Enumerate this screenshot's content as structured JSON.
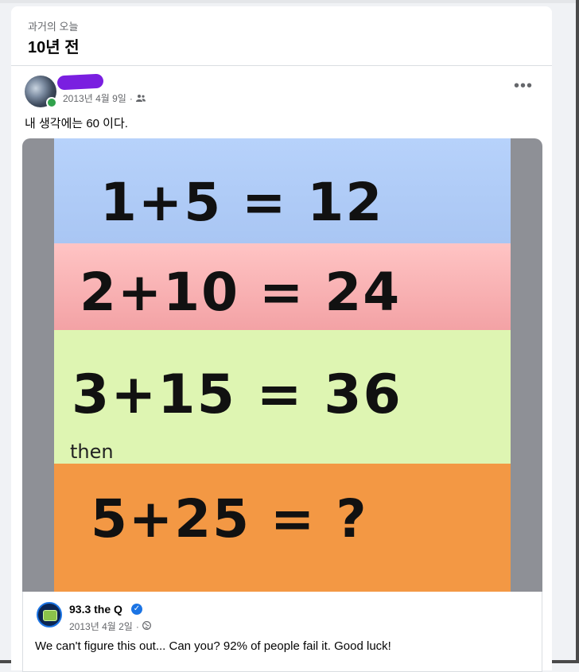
{
  "memory": {
    "subtitle": "과거의 오늘",
    "title": "10년 전"
  },
  "post": {
    "date": "2013년 4월 9일",
    "separator": "·",
    "audience_icon": "friends-icon",
    "text": "내 생각에는 60 이다.",
    "more_icon": "more-horizontal-icon"
  },
  "puzzle": {
    "equations": [
      "1+5 = 12",
      "2+10 = 24",
      "3+15 = 36",
      "5+25 = ?"
    ],
    "connector": "then",
    "colors": {
      "band1": "#b3cdf7",
      "band2": "#f7b0b4",
      "band3": "#def5b4",
      "band4": "#f49a45",
      "frame": "#8e9096"
    }
  },
  "shared": {
    "page_name": "93.3 the Q",
    "date": "2013년 4월 2일",
    "separator": "·",
    "globe_icon": "globe-icon",
    "verified_icon": "verified-badge-icon",
    "text": "We can't figure this out... Can you? 92% of people fail it. Good luck!"
  }
}
